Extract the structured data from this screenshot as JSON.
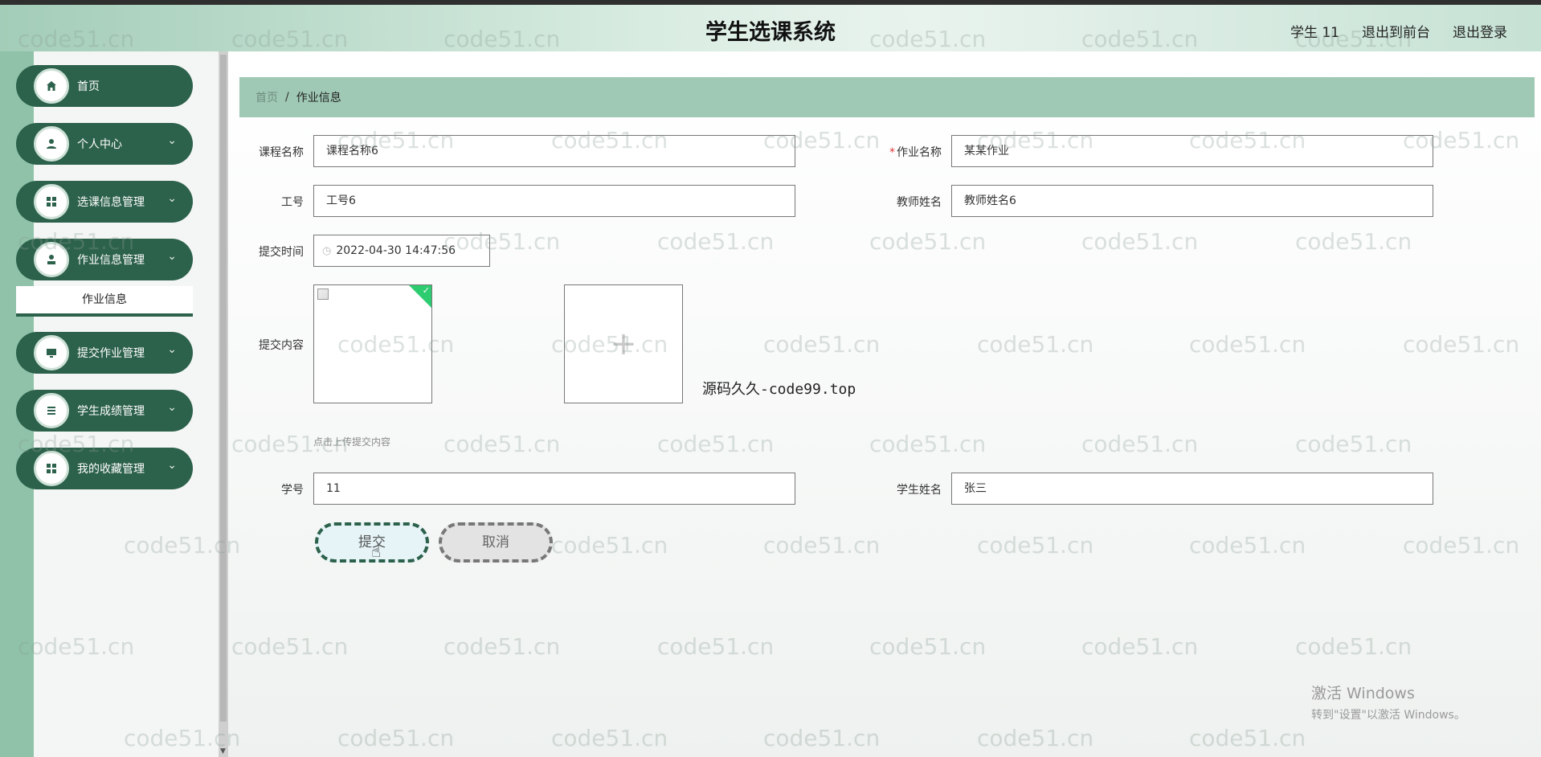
{
  "header": {
    "title": "学生选课系统",
    "user": "学生 11",
    "to_front": "退出到前台",
    "logout": "退出登录"
  },
  "sidebar": {
    "items": [
      {
        "label": "首页",
        "icon": "home-icon"
      },
      {
        "label": "个人中心",
        "icon": "user-icon"
      },
      {
        "label": "选课信息管理",
        "icon": "grid-icon"
      },
      {
        "label": "作业信息管理",
        "icon": "person-icon"
      },
      {
        "label": "提交作业管理",
        "icon": "monitor-icon"
      },
      {
        "label": "学生成绩管理",
        "icon": "list-icon"
      },
      {
        "label": "我的收藏管理",
        "icon": "grid-icon"
      }
    ],
    "submenu_active": "作业信息"
  },
  "breadcrumb": {
    "home": "首页",
    "separator": "/",
    "current": "作业信息"
  },
  "form": {
    "course_name_label": "课程名称",
    "course_name_value": "课程名称6",
    "homework_name_label": "作业名称",
    "homework_name_value": "某某作业",
    "job_no_label": "工号",
    "job_no_value": "工号6",
    "teacher_name_label": "教师姓名",
    "teacher_name_value": "教师姓名6",
    "submit_time_label": "提交时间",
    "submit_time_value": "2022-04-30 14:47:56",
    "content_label": "提交内容",
    "upload_hint": "点击上传提交内容",
    "student_no_label": "学号",
    "student_no_value": "11",
    "student_name_label": "学生姓名",
    "student_name_value": "张三",
    "submit_button": "提交",
    "cancel_button": "取消"
  },
  "overlay_text": "源码久久-code99.top",
  "watermark_text": "code51.cn",
  "windows": {
    "line1": "激活 Windows",
    "line2": "转到\"设置\"以激活 Windows。"
  },
  "colors": {
    "primary_green": "#2c614b",
    "breadcrumb_bg": "#9fc9b5",
    "success_green": "#2ecc71"
  }
}
